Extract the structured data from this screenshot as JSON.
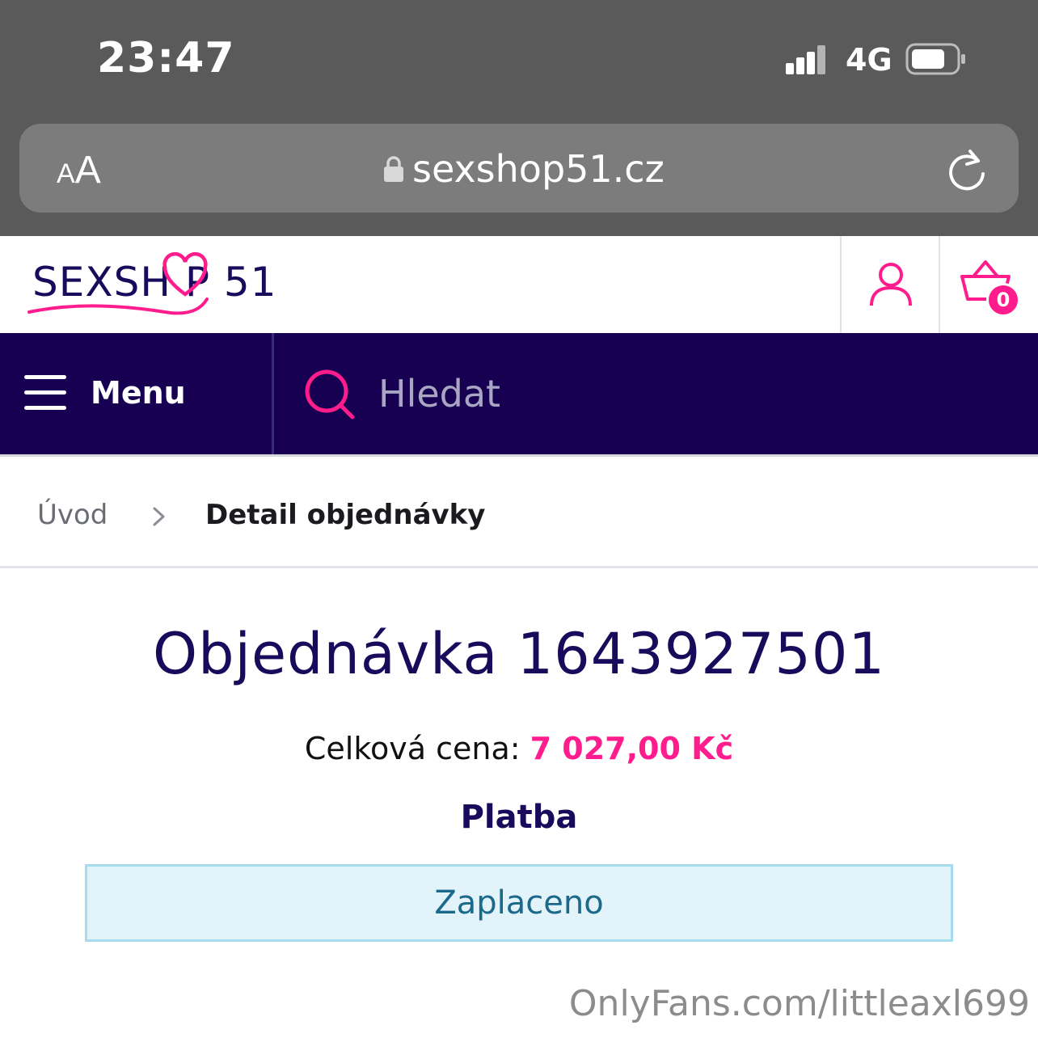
{
  "status_bar": {
    "time": "23:47",
    "network": "4G"
  },
  "browser": {
    "text_size_small": "A",
    "text_size_big": "A",
    "url": "sexshop51.cz"
  },
  "site": {
    "logo_text": "SEXSH  P 51",
    "cart_count": "0",
    "menu_label": "Menu",
    "search_placeholder": "Hledat",
    "brand_colors": {
      "primary": "#170051",
      "accent": "#ff1c8d"
    }
  },
  "breadcrumb": {
    "home": "Úvod",
    "current": "Detail objednávky"
  },
  "order": {
    "title": "Objednávka 1643927501",
    "total_label": "Celková cena: ",
    "total_value": "7 027,00 Kč",
    "payment_heading": "Platba",
    "payment_status": "Zaplaceno"
  },
  "watermark": "OnlyFans.com/littleaxl699",
  "icons": [
    "signal-icon",
    "battery-icon",
    "lock-icon",
    "reload-icon",
    "user-icon",
    "cart-icon",
    "hamburger-icon",
    "search-icon",
    "chevron-right-icon",
    "heart-icon"
  ]
}
